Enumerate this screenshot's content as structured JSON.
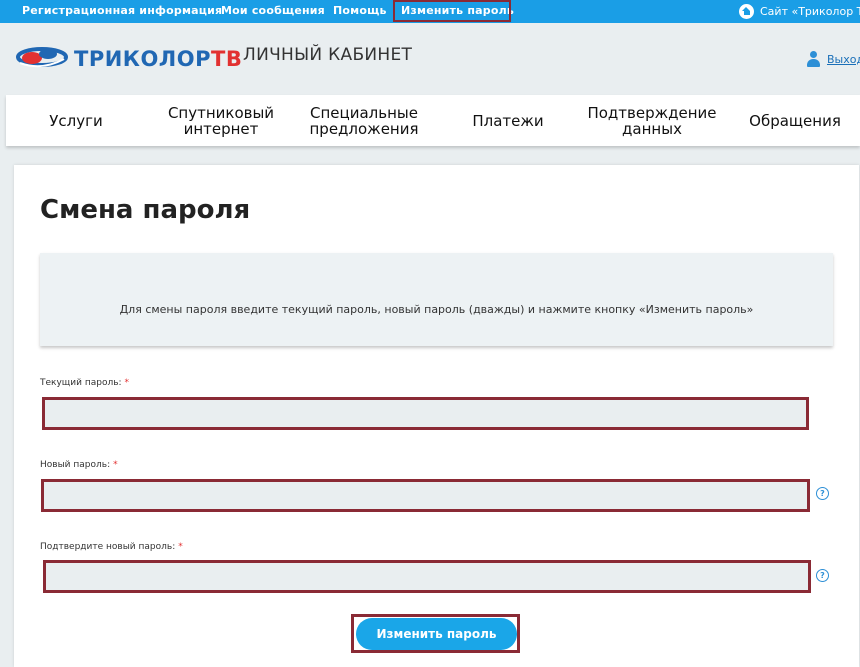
{
  "topbar": {
    "links": [
      "Регистрационная информация",
      "Мои сообщения",
      "Помощь",
      "Изменить пароль"
    ],
    "site_link": "Сайт «Триколор ТВ»",
    "site_icon": "home-icon",
    "bg_color": "#1a9ee6"
  },
  "header": {
    "logo": {
      "tri": "ТРИКОЛОР",
      "tv": "ТВ"
    },
    "cabinet_title": "ЛИЧНЫЙ КАБИНЕТ",
    "logout": "Выход",
    "user_icon": "user-icon"
  },
  "nav": {
    "items": [
      "Услуги",
      "Спутниковый\nинтернет",
      "Специальные\nпредложения",
      "Платежи",
      "Подтверждение\nданных",
      "Обращения"
    ]
  },
  "main": {
    "title": "Смена пароля",
    "info": "Для смены пароля введите текущий пароль, новый пароль (дважды) и нажмите кнопку «Изменить пароль»",
    "fields": [
      {
        "label": "Текущий пароль:",
        "required": "*",
        "value": ""
      },
      {
        "label": "Новый пароль:",
        "required": "*",
        "value": ""
      },
      {
        "label": "Подтвердите новый пароль:",
        "required": "*",
        "value": ""
      }
    ],
    "help_glyph": "?",
    "submit_label": "Изменить пароль"
  },
  "colors": {
    "accent": "#1aa6e8",
    "highlight_border": "#8a2a35",
    "logo_blue": "#2067b3",
    "logo_red": "#e23131"
  }
}
